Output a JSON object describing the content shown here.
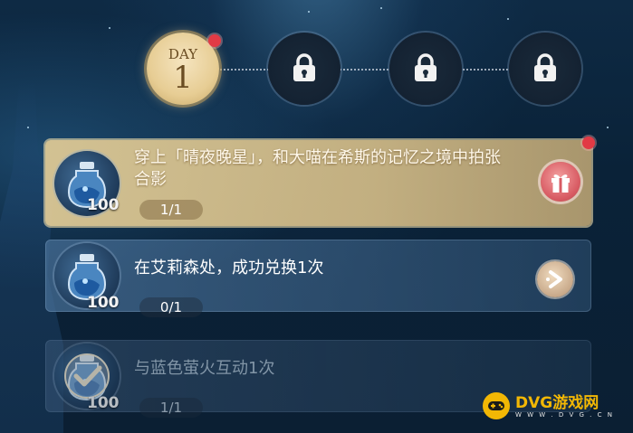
{
  "day_track": {
    "days": [
      {
        "label": "DAY",
        "number": "1",
        "state": "active",
        "has_notification": true
      },
      {
        "state": "locked",
        "icon": "lock-icon"
      },
      {
        "state": "locked",
        "icon": "lock-icon"
      },
      {
        "state": "locked",
        "icon": "lock-icon"
      }
    ]
  },
  "tasks": [
    {
      "text": "穿上「晴夜晚星」，和大喵在希斯的记忆之境中拍张合影",
      "reward_icon": "blue-bottle-icon",
      "reward_count": "100",
      "progress": "1/1",
      "status": "claimable",
      "action_icon": "gift-icon",
      "has_notification": true
    },
    {
      "text": "在艾莉森处，成功兑换1次",
      "reward_icon": "blue-bottle-icon",
      "reward_count": "100",
      "progress": "0/1",
      "status": "in-progress",
      "action_icon": "go-arrow-icon"
    },
    {
      "text": "与蓝色萤火互动1次",
      "reward_icon": "blue-bottle-icon",
      "reward_count": "100",
      "progress": "1/1",
      "status": "completed",
      "action_icon": "checkmark-icon"
    }
  ],
  "watermark": {
    "brand": "DVG游戏网",
    "url": "W W W . D V G . C N"
  },
  "colors": {
    "accent_gold": "#e2cc96",
    "notification_red": "#e23a45",
    "watermark_yellow": "#f2b705"
  }
}
